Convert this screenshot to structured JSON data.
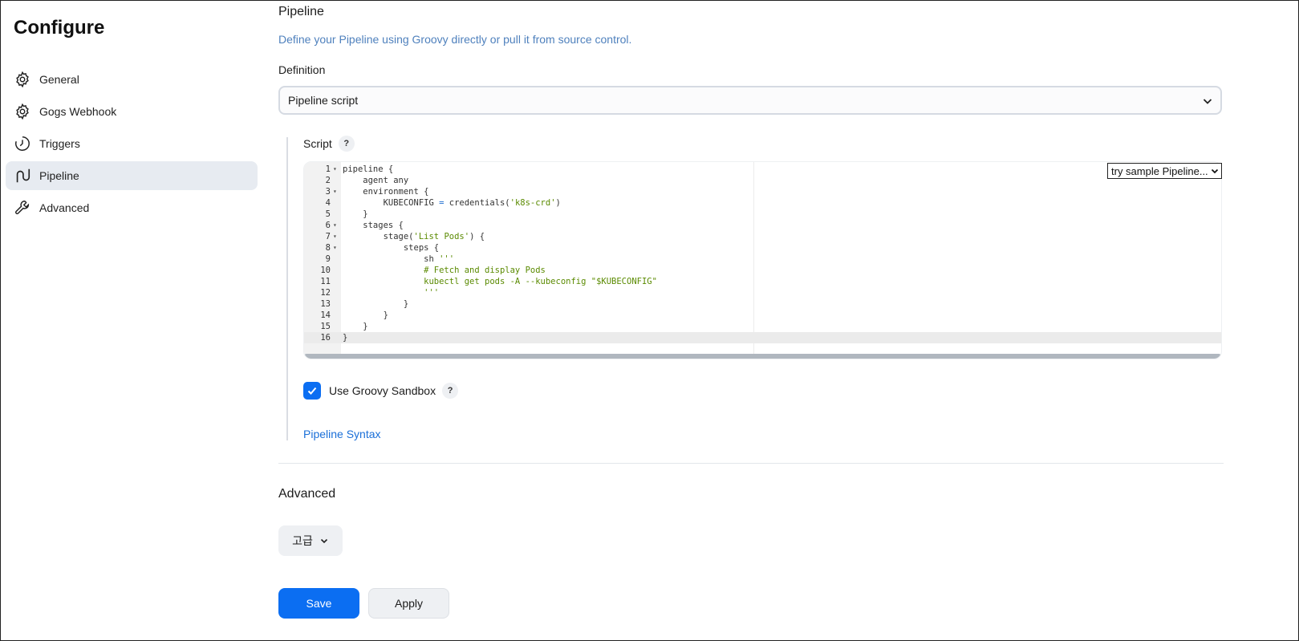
{
  "sidebar": {
    "title": "Configure",
    "items": [
      {
        "label": "General",
        "icon": "gear-icon",
        "active": false
      },
      {
        "label": "Gogs Webhook",
        "icon": "gear-icon",
        "active": false
      },
      {
        "label": "Triggers",
        "icon": "clock-icon",
        "active": false
      },
      {
        "label": "Pipeline",
        "icon": "pipeline-icon",
        "active": true
      },
      {
        "label": "Advanced",
        "icon": "wrench-icon",
        "active": false
      }
    ]
  },
  "pipeline": {
    "title": "Pipeline",
    "description": "Define your Pipeline using Groovy directly or pull it from source control.",
    "definition_label": "Definition",
    "definition_value": "Pipeline script",
    "script_label": "Script",
    "help_mark": "?",
    "sample_select": "try sample Pipeline...",
    "script_lines": [
      "pipeline {",
      "    agent any",
      "    environment {",
      "        KUBECONFIG = credentials('k8s-crd')",
      "    }",
      "    stages {",
      "        stage('List Pods') {",
      "            steps {",
      "                sh '''",
      "                # Fetch and display Pods",
      "                kubectl get pods -A --kubeconfig \"$KUBECONFIG\"",
      "                '''",
      "            }",
      "        }",
      "    }",
      "}"
    ],
    "fold_lines": [
      1,
      3,
      6,
      7,
      8
    ],
    "active_line": 16,
    "sandbox_label": "Use Groovy Sandbox",
    "sandbox_checked": true,
    "syntax_link": "Pipeline Syntax"
  },
  "advanced": {
    "title": "Advanced",
    "button_label": "고급"
  },
  "actions": {
    "save_label": "Save",
    "apply_label": "Apply"
  },
  "colors": {
    "accent": "#0b6ef2",
    "link": "#1a6fd8",
    "description": "#4f81bd",
    "string": "#5a8a00"
  }
}
